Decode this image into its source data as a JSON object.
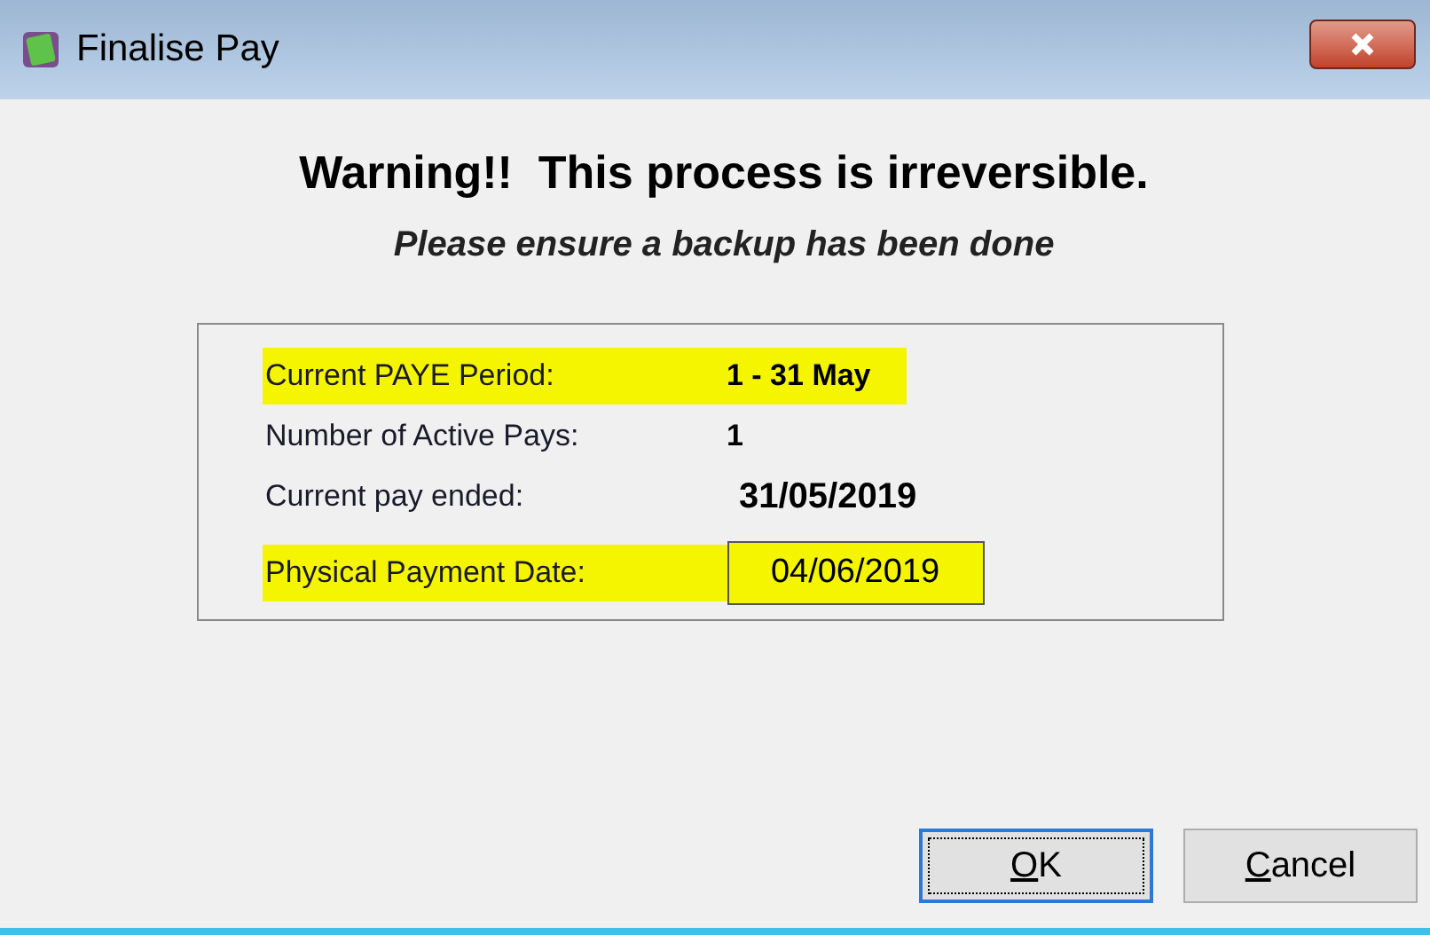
{
  "window": {
    "title": "Finalise Pay"
  },
  "warning": {
    "heading": "Warning!!  This process is irreversible.",
    "subheading": "Please ensure a backup has been done"
  },
  "details": [
    {
      "kind": "value",
      "label": "Current PAYE Period:",
      "value": "1 - 31 May",
      "highlighted": true
    },
    {
      "kind": "value",
      "label": "Number of Active Pays:",
      "value": "1",
      "highlighted": false
    },
    {
      "kind": "large_value",
      "label": "Current pay ended:",
      "value": "31/05/2019",
      "highlighted": false
    },
    {
      "kind": "field",
      "label": "Physical Payment Date:",
      "value": "04/06/2019",
      "highlighted": true
    }
  ],
  "buttons": [
    {
      "accel": "O",
      "rest": "K",
      "default": true
    },
    {
      "accel": "C",
      "rest": "ancel",
      "default": false
    }
  ]
}
